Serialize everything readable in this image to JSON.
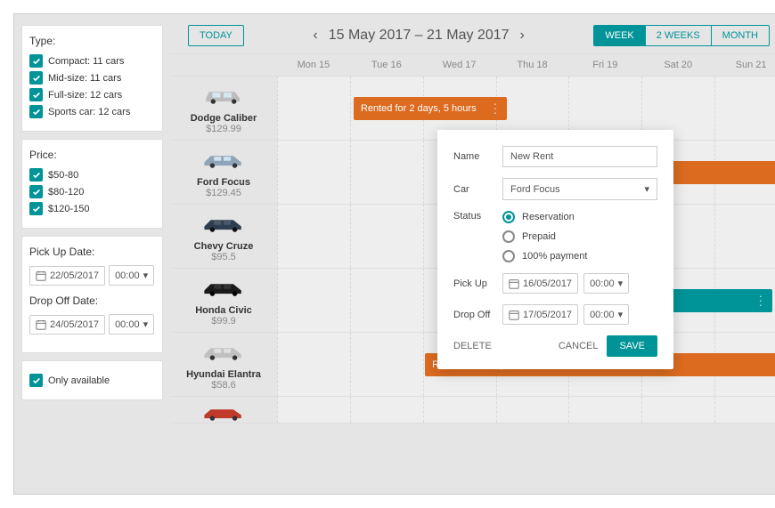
{
  "sidebar": {
    "type": {
      "title": "Type:",
      "items": [
        "Compact: 11 cars",
        "Mid-size: 11 cars",
        "Full-size: 12 cars",
        "Sports car: 12 cars"
      ]
    },
    "price": {
      "title": "Price:",
      "items": [
        "$50-80",
        "$80-120",
        "$120-150"
      ]
    },
    "pickup": {
      "label": "Pick Up Date:",
      "date": "22/05/2017",
      "time": "00:00"
    },
    "dropoff": {
      "label": "Drop Off Date:",
      "date": "24/05/2017",
      "time": "00:00"
    },
    "only_available": "Only available"
  },
  "header": {
    "today": "TODAY",
    "range": "15 May 2017 – 21 May 2017",
    "tabs": [
      "WEEK",
      "2 WEEKS",
      "MONTH"
    ]
  },
  "days": [
    "Mon 15",
    "Tue 16",
    "Wed 17",
    "Thu 18",
    "Fri 19",
    "Sat 20",
    "Sun 21"
  ],
  "cars": [
    {
      "name": "Dodge Caliber",
      "price": "$129.99",
      "color": "#bdbdbd"
    },
    {
      "name": "Ford Focus",
      "price": "$129.45",
      "color": "#8ea4b8"
    },
    {
      "name": "Chevy Cruze",
      "price": "$95.5",
      "color": "#2c3e50"
    },
    {
      "name": "Honda Civic",
      "price": "$99.9",
      "color": "#1a1a1a"
    },
    {
      "name": "Hyundai Elantra",
      "price": "$58.6",
      "color": "#c0c0c0"
    },
    {
      "name": "",
      "price": "",
      "color": "#c0392b"
    }
  ],
  "bars": {
    "b1": "Rented for 2 days, 5 hours",
    "b5": "Rented for 4 days, 22 hours"
  },
  "modal": {
    "name_label": "Name",
    "name_val": "New Rent",
    "car_label": "Car",
    "car_val": "Ford Focus",
    "status_label": "Status",
    "status_opts": [
      "Reservation",
      "Prepaid",
      "100% payment"
    ],
    "pickup_label": "Pick Up",
    "pickup_date": "16/05/2017",
    "pickup_time": "00:00",
    "dropoff_label": "Drop Off",
    "dropoff_date": "17/05/2017",
    "dropoff_time": "00:00",
    "delete": "DELETE",
    "cancel": "CANCEL",
    "save": "SAVE"
  }
}
